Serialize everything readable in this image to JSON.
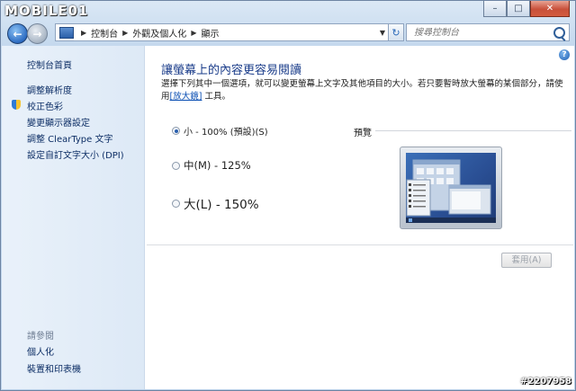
{
  "watermark_top": "MOBILE01",
  "watermark_bottom": "#2207958",
  "address_bar": {
    "crumbs": [
      "控制台",
      "外觀及個人化",
      "顯示"
    ]
  },
  "search": {
    "placeholder": "搜尋控制台"
  },
  "sidebar": {
    "items": [
      {
        "label": "控制台首頁"
      },
      {
        "label": "調整解析度"
      },
      {
        "label": "校正色彩"
      },
      {
        "label": "變更顯示器設定"
      },
      {
        "label": "調整 ClearType 文字"
      },
      {
        "label": "設定自訂文字大小 (DPI)"
      }
    ],
    "see_also_title": "請參閱",
    "see_also": [
      {
        "label": "個人化"
      },
      {
        "label": "裝置和印表機"
      }
    ]
  },
  "main": {
    "title": "讓螢幕上的內容更容易閱讀",
    "description_before": "選擇下列其中一個選項，就可以變更螢幕上文字及其他項目的大小。若只要暫時放大螢幕的某個部分，請使用",
    "description_link": "[放大鏡]",
    "description_after": " 工具。",
    "options": [
      {
        "label": "小 - 100% (預設)(S)",
        "selected": true
      },
      {
        "label": "中(M) - 125%",
        "selected": false
      },
      {
        "label": "大(L) - 150%",
        "selected": false
      }
    ],
    "preview_label": "預覽",
    "apply_label": "套用(A)"
  },
  "colors": {
    "accent": "#1a3c8a",
    "link": "#0b4fb3",
    "sidebar_bg": "#e5eef9"
  }
}
